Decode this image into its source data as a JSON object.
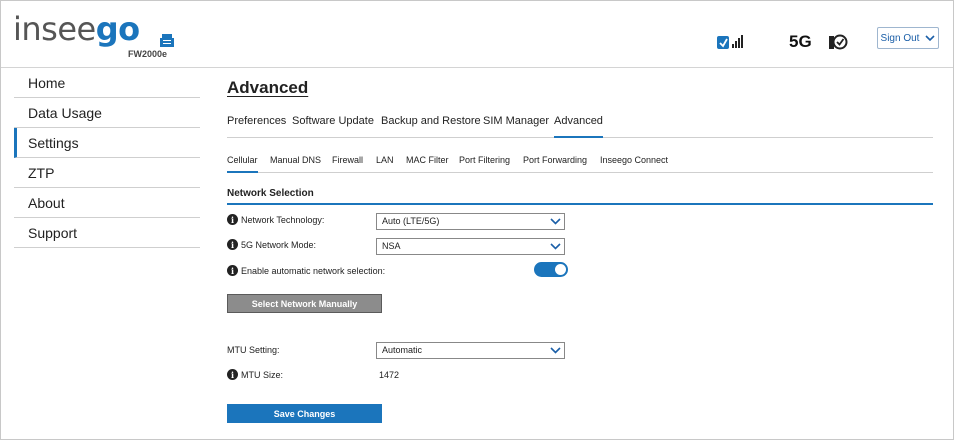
{
  "brand": {
    "logo_main": "insee",
    "logo_accent": "go",
    "model": "FW2000e"
  },
  "status": {
    "network_type": "5G"
  },
  "header": {
    "signout_label": "Sign Out"
  },
  "sidebar": {
    "items": [
      {
        "label": "Home"
      },
      {
        "label": "Data Usage"
      },
      {
        "label": "Settings"
      },
      {
        "label": "ZTP"
      },
      {
        "label": "About"
      },
      {
        "label": "Support"
      }
    ],
    "active_index": 2
  },
  "page": {
    "title": "Advanced"
  },
  "tabs": [
    "Preferences",
    "Software Update",
    "Backup and Restore",
    "SIM Manager",
    "Advanced"
  ],
  "subtabs": [
    "Cellular",
    "Manual DNS",
    "Firewall",
    "LAN",
    "MAC Filter",
    "Port Filtering",
    "Port Forwarding",
    "Inseego Connect"
  ],
  "section": {
    "title": "Network Selection"
  },
  "form": {
    "network_technology": {
      "label": "Network Technology:",
      "value": "Auto (LTE/5G)"
    },
    "network_mode": {
      "label": "5G Network Mode:",
      "value": "NSA"
    },
    "auto_selection": {
      "label": "Enable automatic network selection:",
      "enabled": true
    },
    "select_manually_label": "Select Network Manually",
    "mtu_setting": {
      "label": "MTU Setting:",
      "value": "Automatic"
    },
    "mtu_size": {
      "label": "MTU Size:",
      "value": "1472"
    },
    "save_label": "Save Changes"
  },
  "colors": {
    "accent": "#1b75bc",
    "button_grey": "#8c8c8c"
  }
}
